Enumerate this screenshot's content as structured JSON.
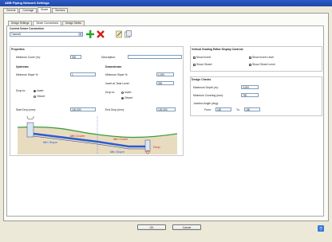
{
  "window": {
    "title": "ABB Piping Network Settings"
  },
  "top_tabs": [
    "General",
    "Coverage",
    "Sewer",
    "Services"
  ],
  "sub_tabs": [
    "Design Settings",
    "Sewer Connections",
    "Design Tables"
  ],
  "connection": {
    "header": "Current Sewer Connection",
    "selected": "Tutorial1"
  },
  "properties": {
    "title": "Properties",
    "min_cover_label": "Minimum Cover (m):",
    "min_cover_value": "900",
    "description_label": "Description:",
    "description_value": "",
    "upstream_title": "Upstream",
    "downstream_title": "Downstream",
    "min_slope_label": "Minimum Slope %:",
    "up_min_slope": "1",
    "down_min_slope": "1.000",
    "invert_depth_label": "Invert at Tank Level:",
    "down_invert_depth": "300",
    "drop_to_label": "Drop to:",
    "opt_invert": "Invert",
    "opt_obvert": "Obvert",
    "start_drop_label": "Start Drop (mm):",
    "up_start_drop": "100.000",
    "end_drop_label": "End Drop (mm):",
    "down_end_drop": "100.000"
  },
  "vertical": {
    "title": "Vertical Grading Editor Display Controls",
    "items": [
      "Show Invert",
      "Show Invert Level",
      "Show Obvert",
      "Show Obvert Level"
    ]
  },
  "checks": {
    "title": "Design Checks",
    "max_depth_label": "Maximum Depth (m):",
    "max_depth": "3.000",
    "min_cover_label": "Minimum Covering (mm):",
    "min_cover": "750",
    "angle_label": "Junction Angle (deg):",
    "from_label": "From:",
    "from_val": "150",
    "to_label": "To:",
    "to_val": "180"
  },
  "diagram": {
    "labels": [
      "Min Cover",
      "Min Cover",
      "Min Slope",
      "Min Slope",
      "Drop"
    ]
  },
  "buttons": {
    "ok": "OK",
    "cancel": "Cancel"
  }
}
